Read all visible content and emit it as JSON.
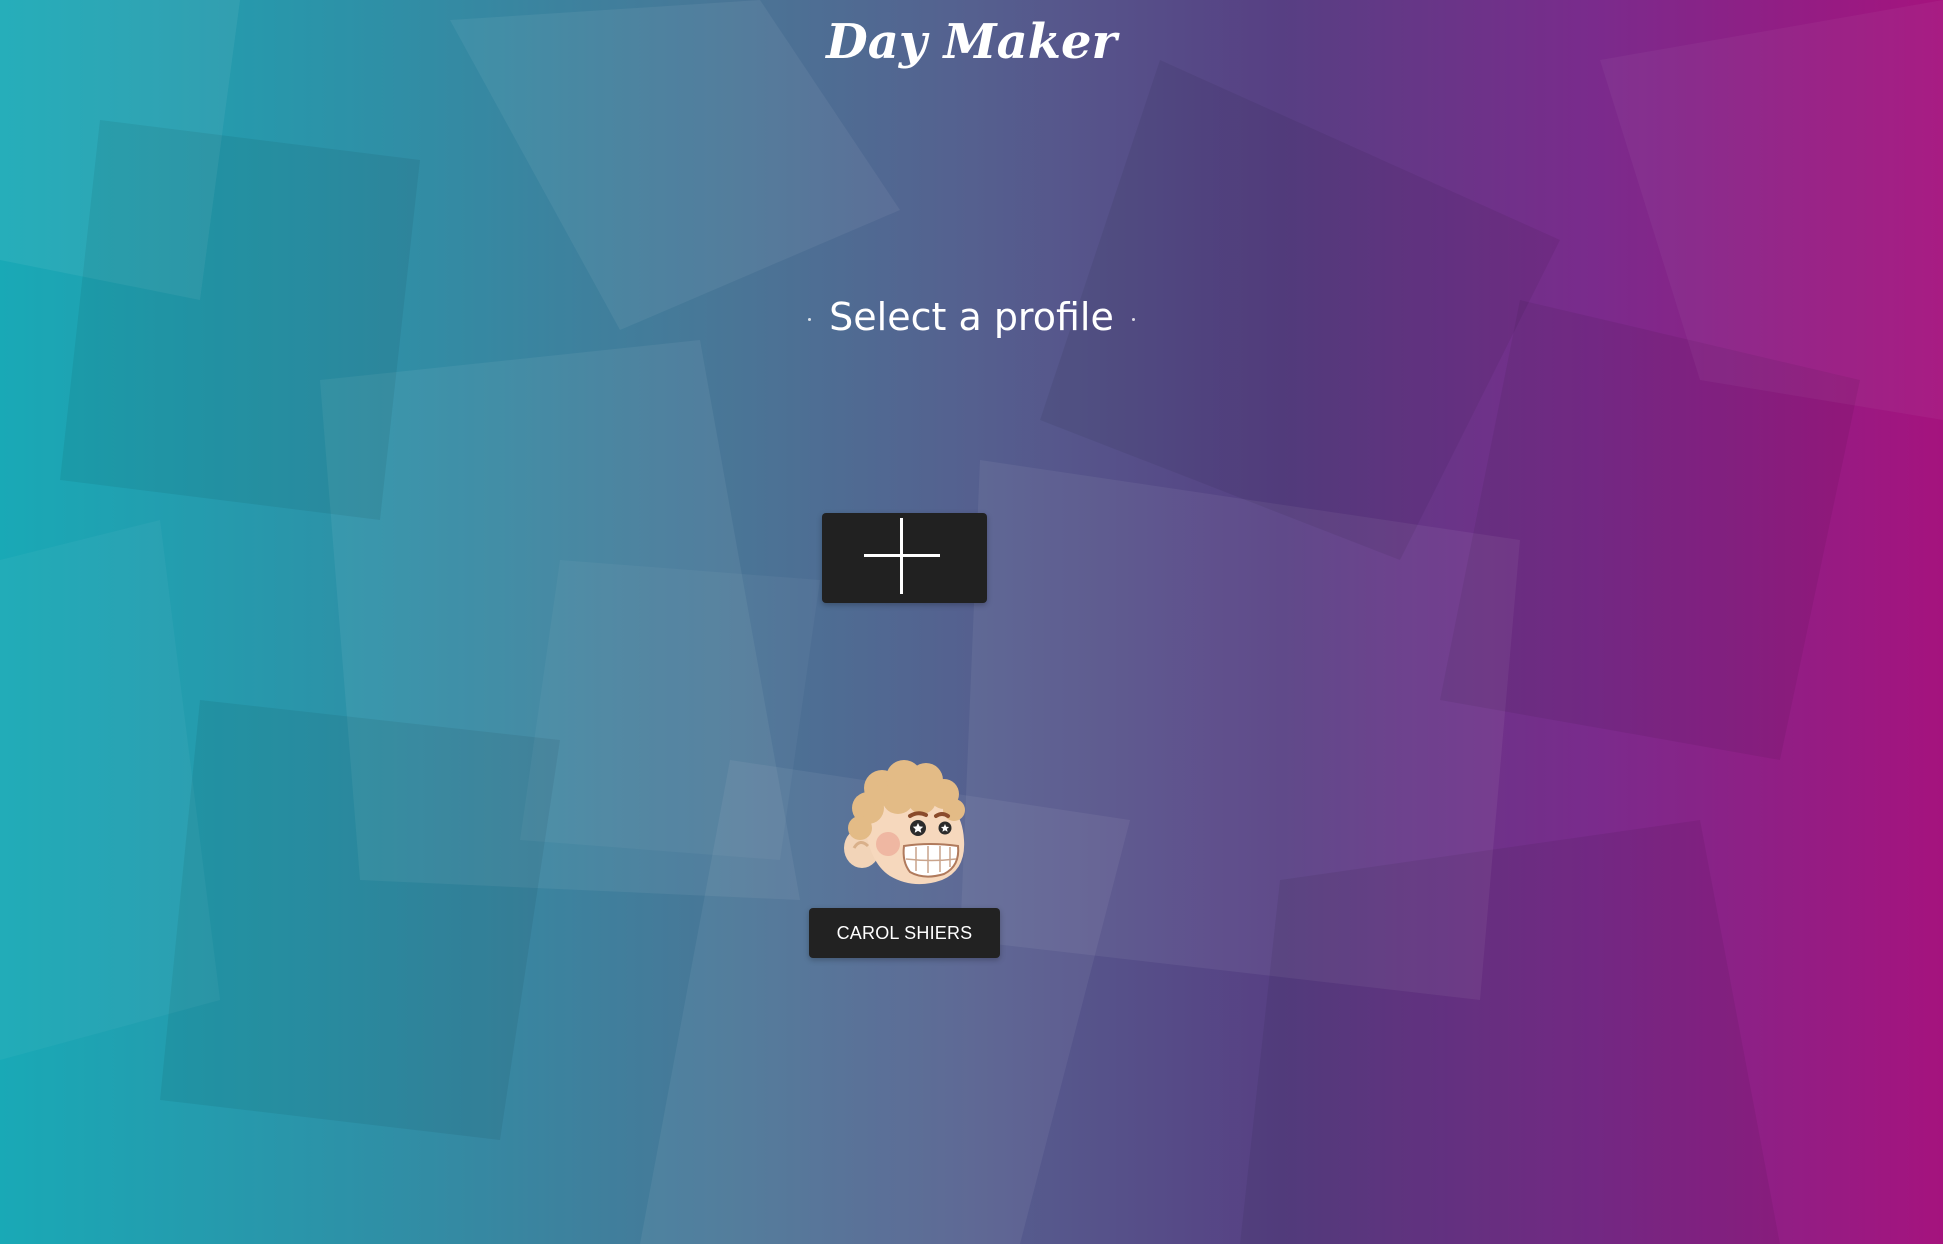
{
  "app": {
    "title": "Day Maker"
  },
  "profile_select": {
    "heading": "Select a profile",
    "add_icon": "plus-icon",
    "profiles": [
      {
        "name": "CAROL SHIERS",
        "avatar": "curly-haired-cartoon-face"
      }
    ]
  },
  "colors": {
    "gradient_left": "#19a9b6",
    "gradient_mid": "#55608f",
    "gradient_right": "#a5137e",
    "button_bg": "#212121",
    "text": "#ffffff"
  }
}
